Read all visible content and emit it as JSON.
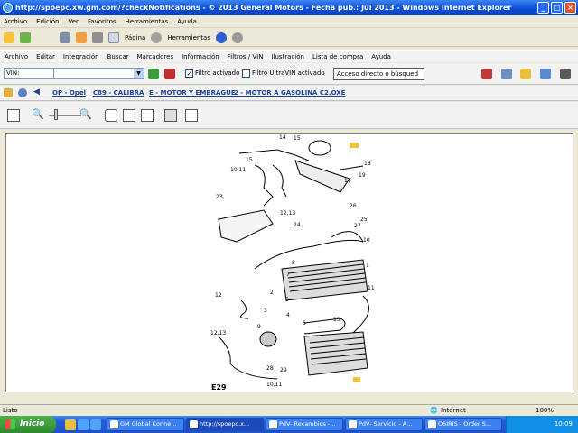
{
  "window": {
    "title": "http://spoepc.xw.gm.com/?checkNotifications - © 2013 General Motors - Fecha pub.: Jul 2013 - Windows Internet Explorer"
  },
  "ie_menu": [
    "Archivo",
    "Edición",
    "Ver",
    "Favoritos",
    "Herramientas",
    "Ayuda"
  ],
  "ie_toolbar": {
    "page_label": "Página",
    "tools_label": "Herramientas"
  },
  "app_menu": [
    "Archivo",
    "Editar",
    "Integración",
    "Buscar",
    "Marcadores",
    "Información",
    "Filtros / VIN",
    "Ilustración",
    "Lista de compra",
    "Ayuda"
  ],
  "vin_bar": {
    "vin_label": "VIN:",
    "filter_label": "Filtro activado",
    "filter_checked": "✓",
    "ultravin_label": "Filtro UltraVIN activado",
    "quick_access": "Acceso directo o búsqued"
  },
  "breadcrumbs": [
    "OP - Opel",
    "C89 - CALIBRA",
    "E - MOTOR Y EMBRAGUE",
    "2 - MOTOR A GASOLINA C2.OXE"
  ],
  "diagram": {
    "figure_id": "E29",
    "callouts": [
      "14",
      "15",
      "15",
      "16",
      "18",
      "19",
      "20",
      "21",
      "22",
      "17",
      "10,11",
      "12,13",
      "23",
      "24",
      "25",
      "26",
      "27",
      "10",
      "8",
      "7",
      "1",
      "2",
      "5",
      "4",
      "3",
      "9",
      "12",
      "13",
      "6",
      "12,13",
      "28",
      "29",
      "11",
      "10,11"
    ],
    "badges": [
      "01",
      "2"
    ]
  },
  "status": {
    "left": "Listo",
    "zone": "Internet",
    "zoom": "100%"
  },
  "taskbar": {
    "start": "Inicio",
    "tasks": [
      "GM Global Conne...",
      "http://spoepc.x...",
      "PdV- Recambios -...",
      "PdV- Servicio - A...",
      "OSIRIS - Order S..."
    ],
    "clock": "10:09"
  }
}
